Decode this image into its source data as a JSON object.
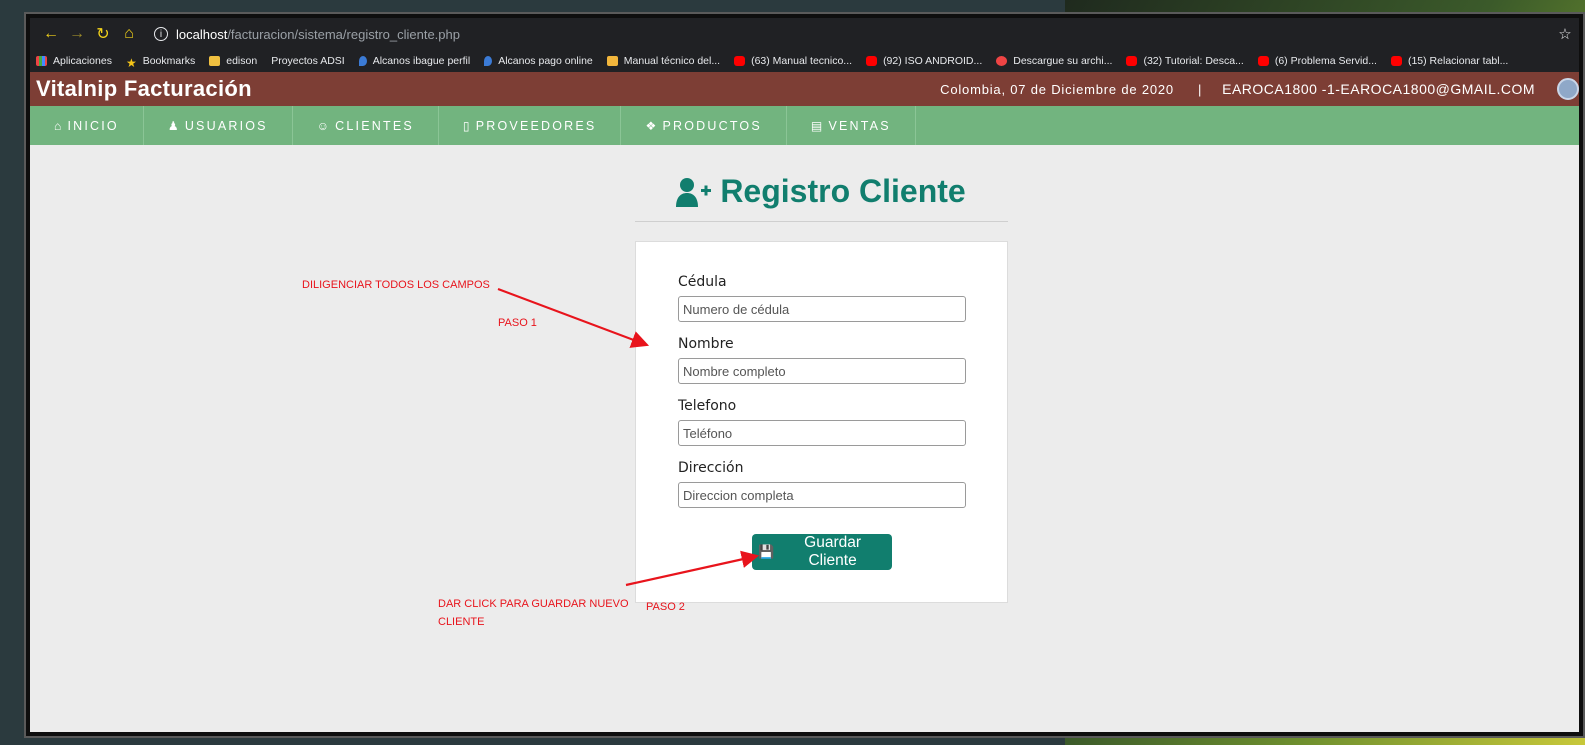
{
  "browser": {
    "url_host": "localhost",
    "url_path": "/facturacion/sistema/registro_cliente.php",
    "bookmarks": [
      {
        "label": "Aplicaciones",
        "icon": "apps-icon"
      },
      {
        "label": "Bookmarks",
        "icon": "star-icon"
      },
      {
        "label": "edison",
        "icon": "folder-icon"
      },
      {
        "label": "Proyectos ADSI",
        "icon": "none"
      },
      {
        "label": "Alcanos ibague perfil",
        "icon": "drop-icon"
      },
      {
        "label": "Alcanos pago online",
        "icon": "drop-icon"
      },
      {
        "label": "Manual técnico del...",
        "icon": "doc-icon"
      },
      {
        "label": "(63) Manual tecnico...",
        "icon": "youtube-icon"
      },
      {
        "label": "(92) ISO ANDROID...",
        "icon": "youtube-icon"
      },
      {
        "label": "Descargue su archi...",
        "icon": "download-icon"
      },
      {
        "label": "(32) Tutorial: Desca...",
        "icon": "youtube-icon"
      },
      {
        "label": "(6) Problema Servid...",
        "icon": "youtube-icon"
      },
      {
        "label": "(15) Relacionar tabl...",
        "icon": "youtube-icon"
      }
    ]
  },
  "header": {
    "brand": "Vitalnip Facturación",
    "date": "Colombia, 07 de Diciembre de 2020",
    "separator": "|",
    "user": "EAROCA1800 -1-EAROCA1800@GMAIL.COM"
  },
  "menu": [
    {
      "label": "INICIO",
      "icon": "home-icon"
    },
    {
      "label": "USUARIOS",
      "icon": "users-icon"
    },
    {
      "label": "CLIENTES",
      "icon": "user-icon"
    },
    {
      "label": "PROVEEDORES",
      "icon": "building-icon"
    },
    {
      "label": "PRODUCTOS",
      "icon": "cubes-icon"
    },
    {
      "label": "VENTAS",
      "icon": "file-icon"
    }
  ],
  "page": {
    "title": "Registro Cliente"
  },
  "form": {
    "fields": [
      {
        "label": "Cédula",
        "placeholder": "Numero de cédula",
        "value": ""
      },
      {
        "label": "Nombre",
        "placeholder": "Nombre completo",
        "value": ""
      },
      {
        "label": "Telefono",
        "placeholder": "Teléfono",
        "value": ""
      },
      {
        "label": "Dirección",
        "placeholder": "Direccion completa",
        "value": ""
      }
    ],
    "submit_label": "Guardar Cliente"
  },
  "annotations": {
    "step1_text": "DILIGENCIAR TODOS LOS CAMPOS",
    "step1_label": "PASO 1",
    "step2_text_line1": "DAR CLICK PARA GUARDAR NUEVO",
    "step2_text_line2": "CLIENTE",
    "step2_label": "PASO 2"
  },
  "colors": {
    "header_bg": "#7d3e35",
    "menu_bg": "#72b47f",
    "accent": "#117e6e",
    "annotation": "#e8141c"
  }
}
